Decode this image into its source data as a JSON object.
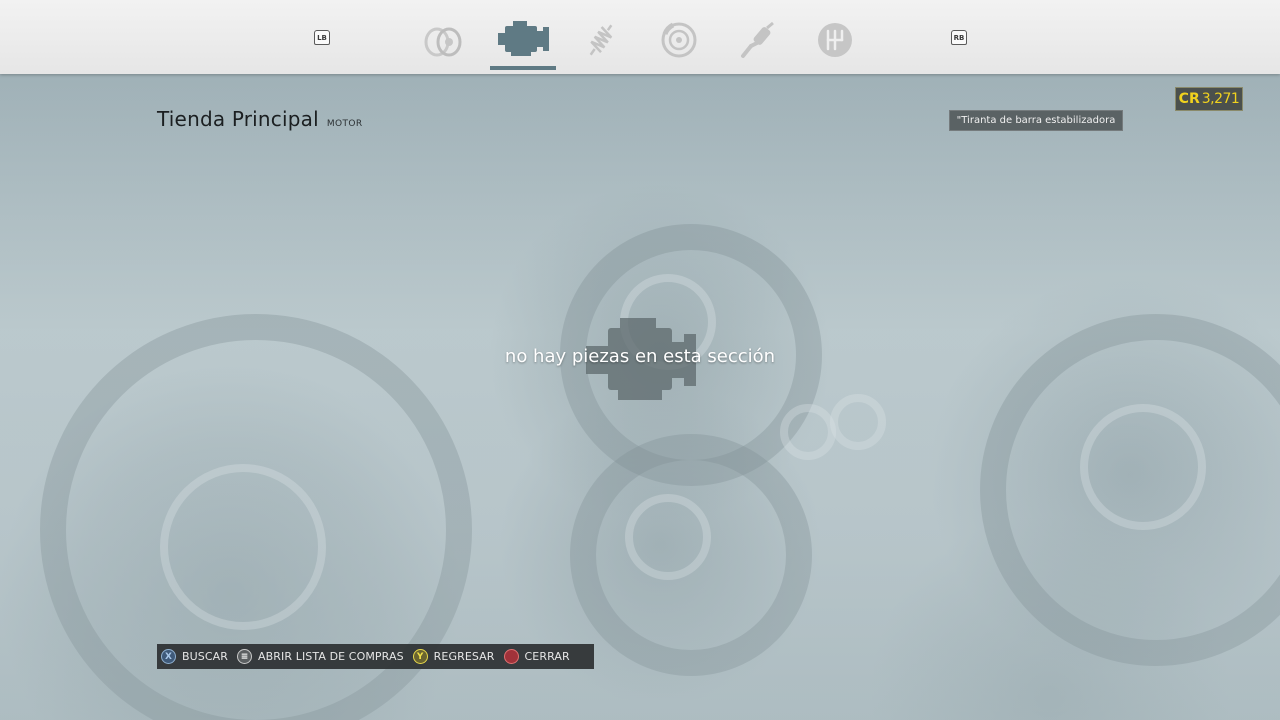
{
  "nav": {
    "left_bumper": "LB",
    "right_bumper": "RB",
    "tabs": [
      {
        "name": "tab-tires",
        "icon": "tire-rim-icon",
        "active": false
      },
      {
        "name": "tab-engine",
        "icon": "engine-icon",
        "active": true
      },
      {
        "name": "tab-suspension",
        "icon": "spring-icon",
        "active": false
      },
      {
        "name": "tab-brakes",
        "icon": "brake-disc-icon",
        "active": false
      },
      {
        "name": "tab-exhaust",
        "icon": "exhaust-pipe-icon",
        "active": false
      },
      {
        "name": "tab-transmission",
        "icon": "gear-shifter-icon",
        "active": false
      }
    ]
  },
  "header": {
    "title": "Tienda Principal",
    "subtitle": "MOTOR"
  },
  "credits": {
    "prefix": "CR",
    "value": "3,271",
    "color": "#f0d21e"
  },
  "tip": {
    "text": "\"Tiranta de barra estabilizadora"
  },
  "main": {
    "empty_message": "no hay piezas en esta sección",
    "empty_icon": "engine-icon"
  },
  "hints": [
    {
      "button": "X",
      "label": "BUSCAR"
    },
    {
      "button": "≡",
      "label": "ABRIR LISTA DE COMPRAS"
    },
    {
      "button": "Y",
      "label": "REGRESAR"
    },
    {
      "button": "",
      "label": "CERRAR"
    }
  ],
  "colors": {
    "accent": "#5f7a84",
    "topbar": "#eeeeee",
    "hint_bar": "#2c3032"
  }
}
